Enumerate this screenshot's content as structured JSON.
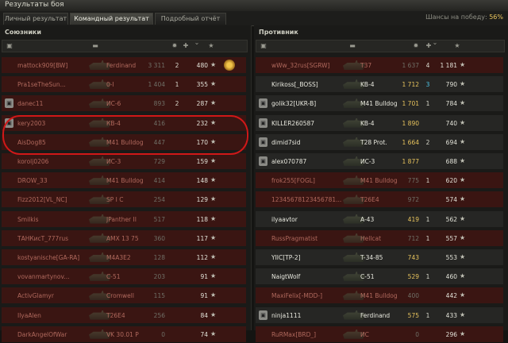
{
  "window": {
    "title": "Результаты боя"
  },
  "tabs": [
    {
      "label": "Личный результат",
      "active": false
    },
    {
      "label": "Командный результат",
      "active": true
    },
    {
      "label": "Подробный отчёт",
      "active": false
    }
  ],
  "win_chance": {
    "label": "Шансы на победу:",
    "value": "56%"
  },
  "allies": {
    "title": "Союзники",
    "rows": [
      {
        "player": "mattock909[BW]",
        "tank": "Ferdinand",
        "damage": "3 311",
        "kills": "2",
        "xp": "480",
        "dead": true,
        "clan": false,
        "medal": true
      },
      {
        "player": "Pra1seTheSun...",
        "tank": "0-I",
        "damage": "1 404",
        "kills": "1",
        "xp": "355",
        "dead": true,
        "clan": false
      },
      {
        "player": "danec11",
        "tank": "ИС-6",
        "damage": "893",
        "kills": "2",
        "xp": "287",
        "dead": true,
        "clan": true
      },
      {
        "player": "kery2003",
        "tank": "КВ-4",
        "damage": "416",
        "kills": "",
        "xp": "232",
        "dead": true,
        "clan": true
      },
      {
        "player": "AisDog85",
        "tank": "M41 Bulldog",
        "damage": "447",
        "kills": "",
        "xp": "170",
        "dead": true,
        "clan": false
      },
      {
        "player": "korolj0206",
        "tank": "ИС-3",
        "damage": "729",
        "kills": "",
        "xp": "159",
        "dead": true,
        "clan": false
      },
      {
        "player": "DROW_33",
        "tank": "M41 Bulldog",
        "damage": "414",
        "kills": "",
        "xp": "148",
        "dead": true,
        "clan": false
      },
      {
        "player": "Fizz2012[VL_NC]",
        "tank": "SP I C",
        "damage": "254",
        "kills": "",
        "xp": "129",
        "dead": true,
        "clan": false
      },
      {
        "player": "Smilkis",
        "tank": "JPanther II",
        "damage": "517",
        "kills": "",
        "xp": "118",
        "dead": true,
        "clan": false
      },
      {
        "player": "ТАНКисТ_777rus",
        "tank": "AMX 13 75",
        "damage": "360",
        "kills": "",
        "xp": "117",
        "dead": true,
        "clan": false
      },
      {
        "player": "kostyanische[GA-RA]",
        "tank": "M4A3E2",
        "damage": "128",
        "kills": "",
        "xp": "112",
        "dead": true,
        "clan": false
      },
      {
        "player": "vovanmartynov...",
        "tank": "C-51",
        "damage": "203",
        "kills": "",
        "xp": "91",
        "dead": true,
        "clan": false
      },
      {
        "player": "ActivGlamyr",
        "tank": "Cromwell",
        "damage": "115",
        "kills": "",
        "xp": "91",
        "dead": true,
        "clan": false
      },
      {
        "player": "IlyaAlen",
        "tank": "T26E4",
        "damage": "256",
        "kills": "",
        "xp": "84",
        "dead": true,
        "clan": false
      },
      {
        "player": "DarkAngelOfWar",
        "tank": "VK 30.01 P",
        "damage": "0",
        "kills": "",
        "xp": "74",
        "dead": true,
        "clan": false
      }
    ]
  },
  "enemies": {
    "title": "Противник",
    "rows": [
      {
        "player": "wWw_32rus[SGRW]",
        "tank": "T37",
        "damage": "1 637",
        "kills": "4",
        "xp": "1 181",
        "dead": true,
        "clan": false
      },
      {
        "player": "Kirikoss[_BOSS]",
        "tank": "KB-4",
        "damage": "1 712",
        "kills": "3",
        "xp": "790",
        "dead": false,
        "clan": false
      },
      {
        "player": "golik32[UKR-B]",
        "tank": "M41 Bulldog",
        "damage": "1 701",
        "kills": "1",
        "xp": "784",
        "dead": false,
        "clan": true
      },
      {
        "player": "KILLER260587",
        "tank": "KB-4",
        "damage": "1 890",
        "kills": "",
        "xp": "740",
        "dead": false,
        "clan": true
      },
      {
        "player": "dimid7sid",
        "tank": "T28 Prot.",
        "damage": "1 664",
        "kills": "2",
        "xp": "694",
        "dead": false,
        "clan": true
      },
      {
        "player": "alex070787",
        "tank": "ИС-3",
        "damage": "1 877",
        "kills": "",
        "xp": "688",
        "dead": false,
        "clan": true
      },
      {
        "player": "frok255[FOGL]",
        "tank": "M41 Bulldog",
        "damage": "775",
        "kills": "1",
        "xp": "620",
        "dead": true,
        "clan": false
      },
      {
        "player": "12345678123456781...",
        "tank": "T26E4",
        "damage": "972",
        "kills": "",
        "xp": "574",
        "dead": true,
        "clan": false
      },
      {
        "player": "ilyaavtor",
        "tank": "A-43",
        "damage": "419",
        "kills": "1",
        "xp": "562",
        "dead": false,
        "clan": false
      },
      {
        "player": "RussPragmatist",
        "tank": "Hellcat",
        "damage": "712",
        "kills": "1",
        "xp": "557",
        "dead": true,
        "clan": false
      },
      {
        "player": "YIIC[TP-2]",
        "tank": "T-34-85",
        "damage": "743",
        "kills": "",
        "xp": "553",
        "dead": false,
        "clan": false
      },
      {
        "player": "NaigtWolf",
        "tank": "C-51",
        "damage": "529",
        "kills": "1",
        "xp": "460",
        "dead": false,
        "clan": false
      },
      {
        "player": "MaxiFelix[-MDD-]",
        "tank": "M41 Bulldog",
        "damage": "400",
        "kills": "",
        "xp": "442",
        "dead": true,
        "clan": false
      },
      {
        "player": "ninja1111",
        "tank": "Ferdinand",
        "damage": "575",
        "kills": "1",
        "xp": "433",
        "dead": false,
        "clan": true
      },
      {
        "player": "RuRMax[BRD_]",
        "tank": "ИС",
        "damage": "0",
        "kills": "",
        "xp": "296",
        "dead": true,
        "clan": false
      }
    ]
  },
  "colors": {
    "dead_row": "#3a1512",
    "alive_row": "#262624",
    "dead_text": "#b0695d",
    "alive_text": "#e8e8de",
    "damage_alive": "#e7c35d",
    "kills": "#4ec6e8",
    "highlight": "#d01818"
  },
  "icons": {
    "clan": "clan-icon",
    "medal": "medal-icon",
    "star": "star-icon",
    "sort": "sort-arrow-icon"
  }
}
